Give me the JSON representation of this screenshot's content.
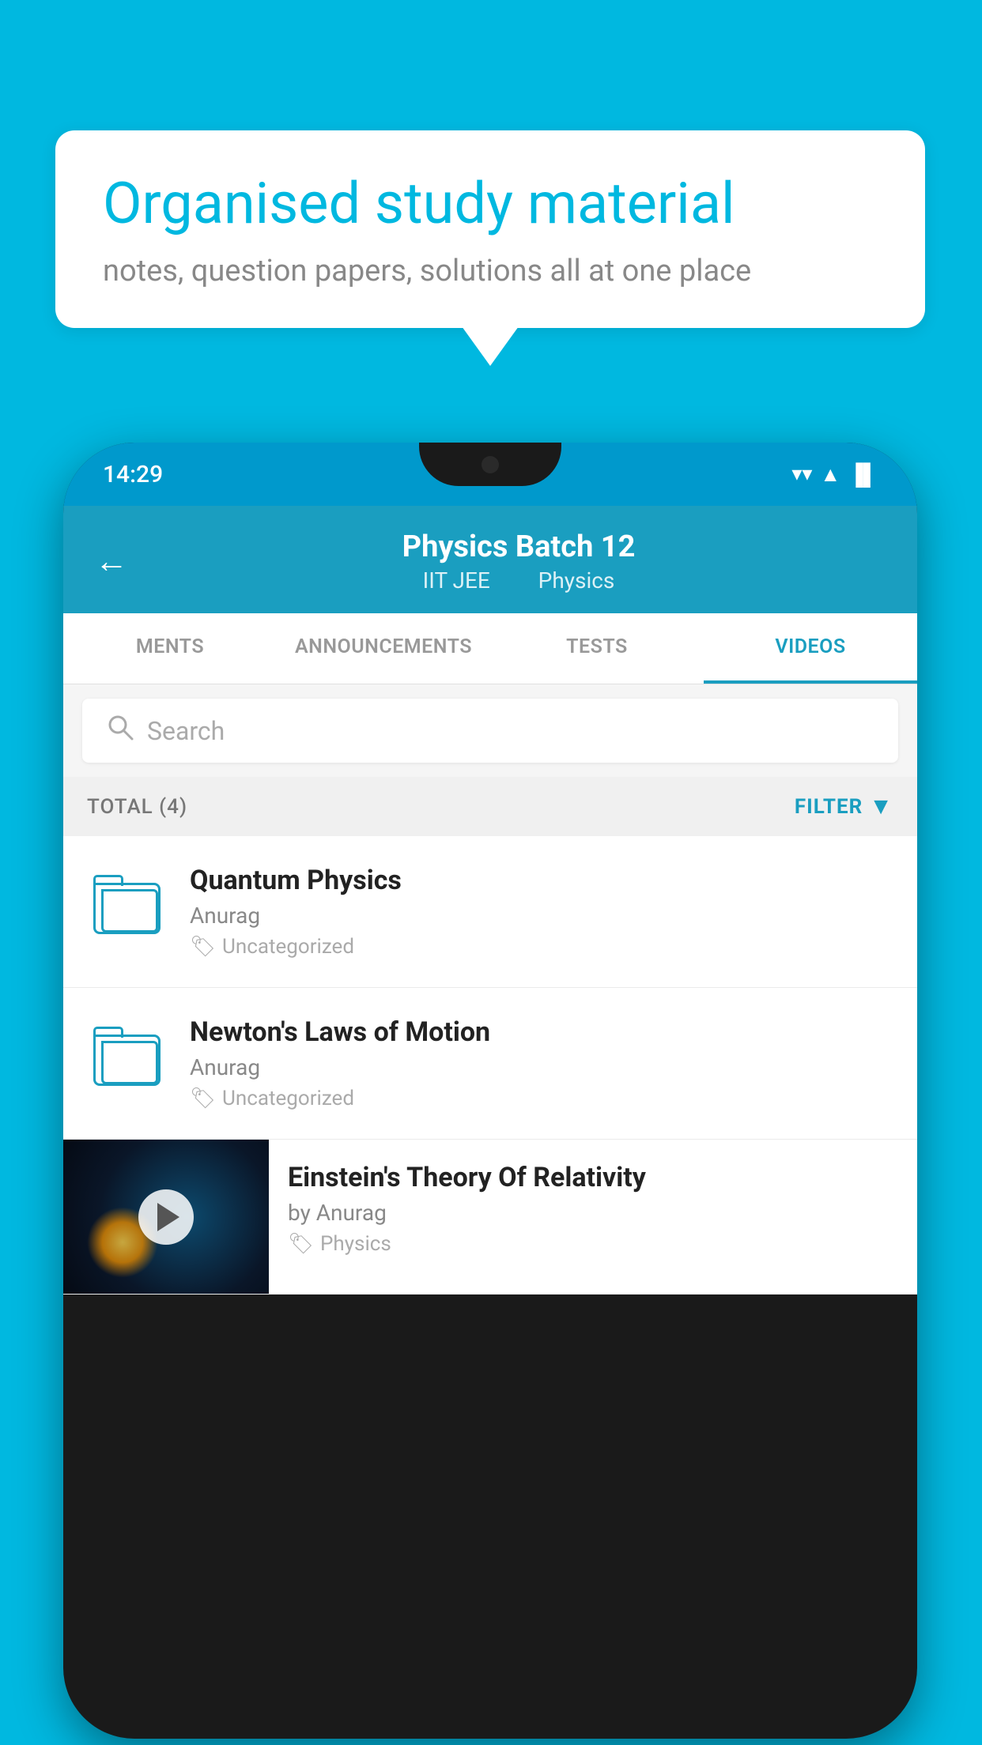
{
  "background_color": "#00b8e0",
  "bubble": {
    "title": "Organised study material",
    "subtitle": "notes, question papers, solutions all at one place"
  },
  "phone": {
    "status_bar": {
      "time": "14:29",
      "wifi": "▼",
      "signal": "▲",
      "battery": "▮"
    },
    "header": {
      "back_label": "←",
      "title": "Physics Batch 12",
      "tag1": "IIT JEE",
      "tag2": "Physics"
    },
    "tabs": [
      {
        "label": "MENTS",
        "active": false
      },
      {
        "label": "ANNOUNCEMENTS",
        "active": false
      },
      {
        "label": "TESTS",
        "active": false
      },
      {
        "label": "VIDEOS",
        "active": true
      }
    ],
    "search": {
      "placeholder": "Search"
    },
    "filter_bar": {
      "total_label": "TOTAL (4)",
      "filter_label": "FILTER"
    },
    "videos": [
      {
        "title": "Quantum Physics",
        "author": "Anurag",
        "tag": "Uncategorized",
        "has_thumb": false
      },
      {
        "title": "Newton's Laws of Motion",
        "author": "Anurag",
        "tag": "Uncategorized",
        "has_thumb": false
      },
      {
        "title": "Einstein's Theory Of Relativity",
        "author": "by Anurag",
        "tag": "Physics",
        "has_thumb": true
      }
    ]
  }
}
